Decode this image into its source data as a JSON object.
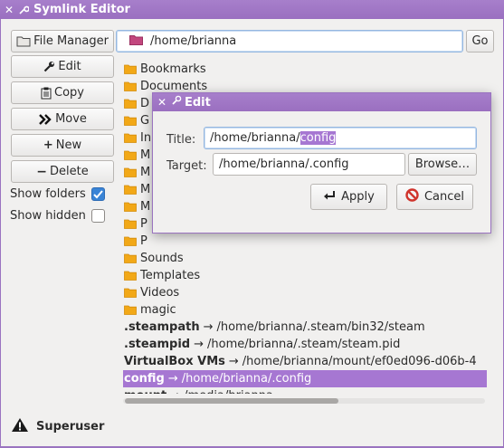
{
  "window": {
    "title": "Symlink Editor"
  },
  "sidebar": {
    "buttons": [
      {
        "label": "File Manager",
        "icon": "folder-icon"
      },
      {
        "label": "Edit",
        "icon": "wrench-icon"
      },
      {
        "label": "Copy",
        "icon": "clipboard-icon"
      },
      {
        "label": "Move",
        "icon": "double-chevron-right-icon"
      },
      {
        "label": "New",
        "icon": "plus-icon"
      },
      {
        "label": "Delete",
        "icon": "minus-icon"
      }
    ],
    "show_folders": {
      "label": "Show folders",
      "checked": true
    },
    "show_hidden": {
      "label": "Show hidden",
      "checked": false
    }
  },
  "pathbar": {
    "value": "/home/brianna",
    "go_label": "Go"
  },
  "list": {
    "folders": [
      "Bookmarks",
      "Documents",
      "D",
      "G",
      "In",
      "M",
      "M",
      "M",
      "M",
      "P",
      "P",
      "Sounds",
      "Templates",
      "Videos",
      "magic"
    ],
    "links": [
      {
        "name": ".steampath",
        "target": "/home/brianna/.steam/bin32/steam"
      },
      {
        "name": ".steampid",
        "target": "/home/brianna/.steam/steam.pid"
      },
      {
        "name": "VirtualBox VMs",
        "target": "/home/brianna/mount/ef0ed096-d06b-4"
      },
      {
        "name": "config",
        "target": "/home/brianna/.config"
      },
      {
        "name": "mount",
        "target": "/media/brianna"
      }
    ],
    "arrow": "→"
  },
  "status": {
    "label": "Superuser"
  },
  "dialog": {
    "title": "Edit",
    "title_label": "Title:",
    "title_value_prefix": "/home/brianna/",
    "title_value_selected": "config",
    "target_label": "Target:",
    "target_value": "/home/brianna/.config",
    "browse_label": "Browse…",
    "apply_label": "Apply",
    "cancel_label": "Cancel"
  },
  "colors": {
    "accent": "#a677d2",
    "titlebar": "#9a6fc0",
    "folder": "#f2a817",
    "checkbox": "#3a84d6",
    "cancel": "#d0342c"
  }
}
